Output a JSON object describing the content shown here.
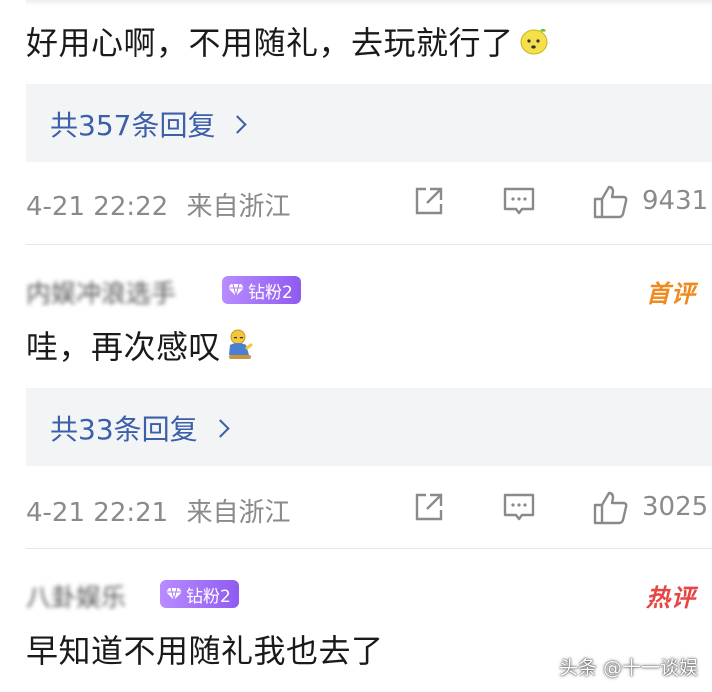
{
  "comments": [
    {
      "text": "好用心啊，不用随礼，去玩就行了",
      "emoji": "lemon-face-emoji",
      "reply_label": "共357条回复",
      "time": "4-21 22:22",
      "location": "来自浙江",
      "likes": "9431"
    },
    {
      "username": "内娱冲浪选手",
      "badge": "钻粉2",
      "tag": "首评",
      "text": "哇，再次感叹",
      "emoji": "kneeling-emoji",
      "reply_label": "共33条回复",
      "time": "4-21 22:21",
      "location": "来自浙江",
      "likes": "3025"
    },
    {
      "username": "八卦娱乐",
      "badge": "钻粉2",
      "tag": "热评",
      "text": "早知道不用随礼我也去了"
    }
  ],
  "watermark": "头条 @十一谈娱",
  "colors": {
    "reply_link": "#3b5fa8",
    "meta_gray": "#8a8a8a",
    "badge_purple": "#8f5bf0",
    "first_tag": "#f08a1c",
    "hot_tag": "#e84545",
    "reply_bg": "#f3f4f6"
  }
}
